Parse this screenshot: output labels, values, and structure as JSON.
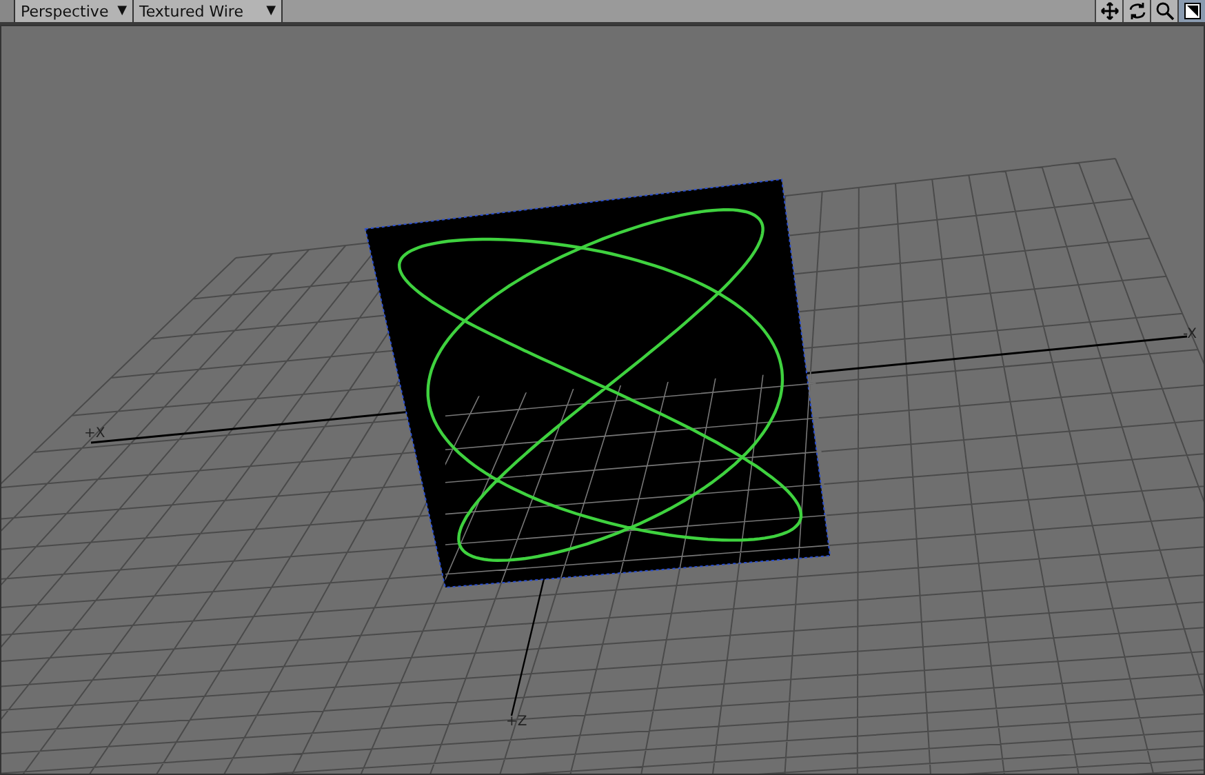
{
  "toolbar": {
    "view_mode": "Perspective",
    "shading_mode": "Textured Wire",
    "dropdown_arrow": "▼"
  },
  "viewport": {
    "axis_labels": [
      {
        "text": "+X",
        "kind": "x_pos"
      },
      {
        "text": "-X",
        "kind": "x_neg"
      },
      {
        "text": "+Z",
        "kind": "z_pos"
      }
    ]
  }
}
